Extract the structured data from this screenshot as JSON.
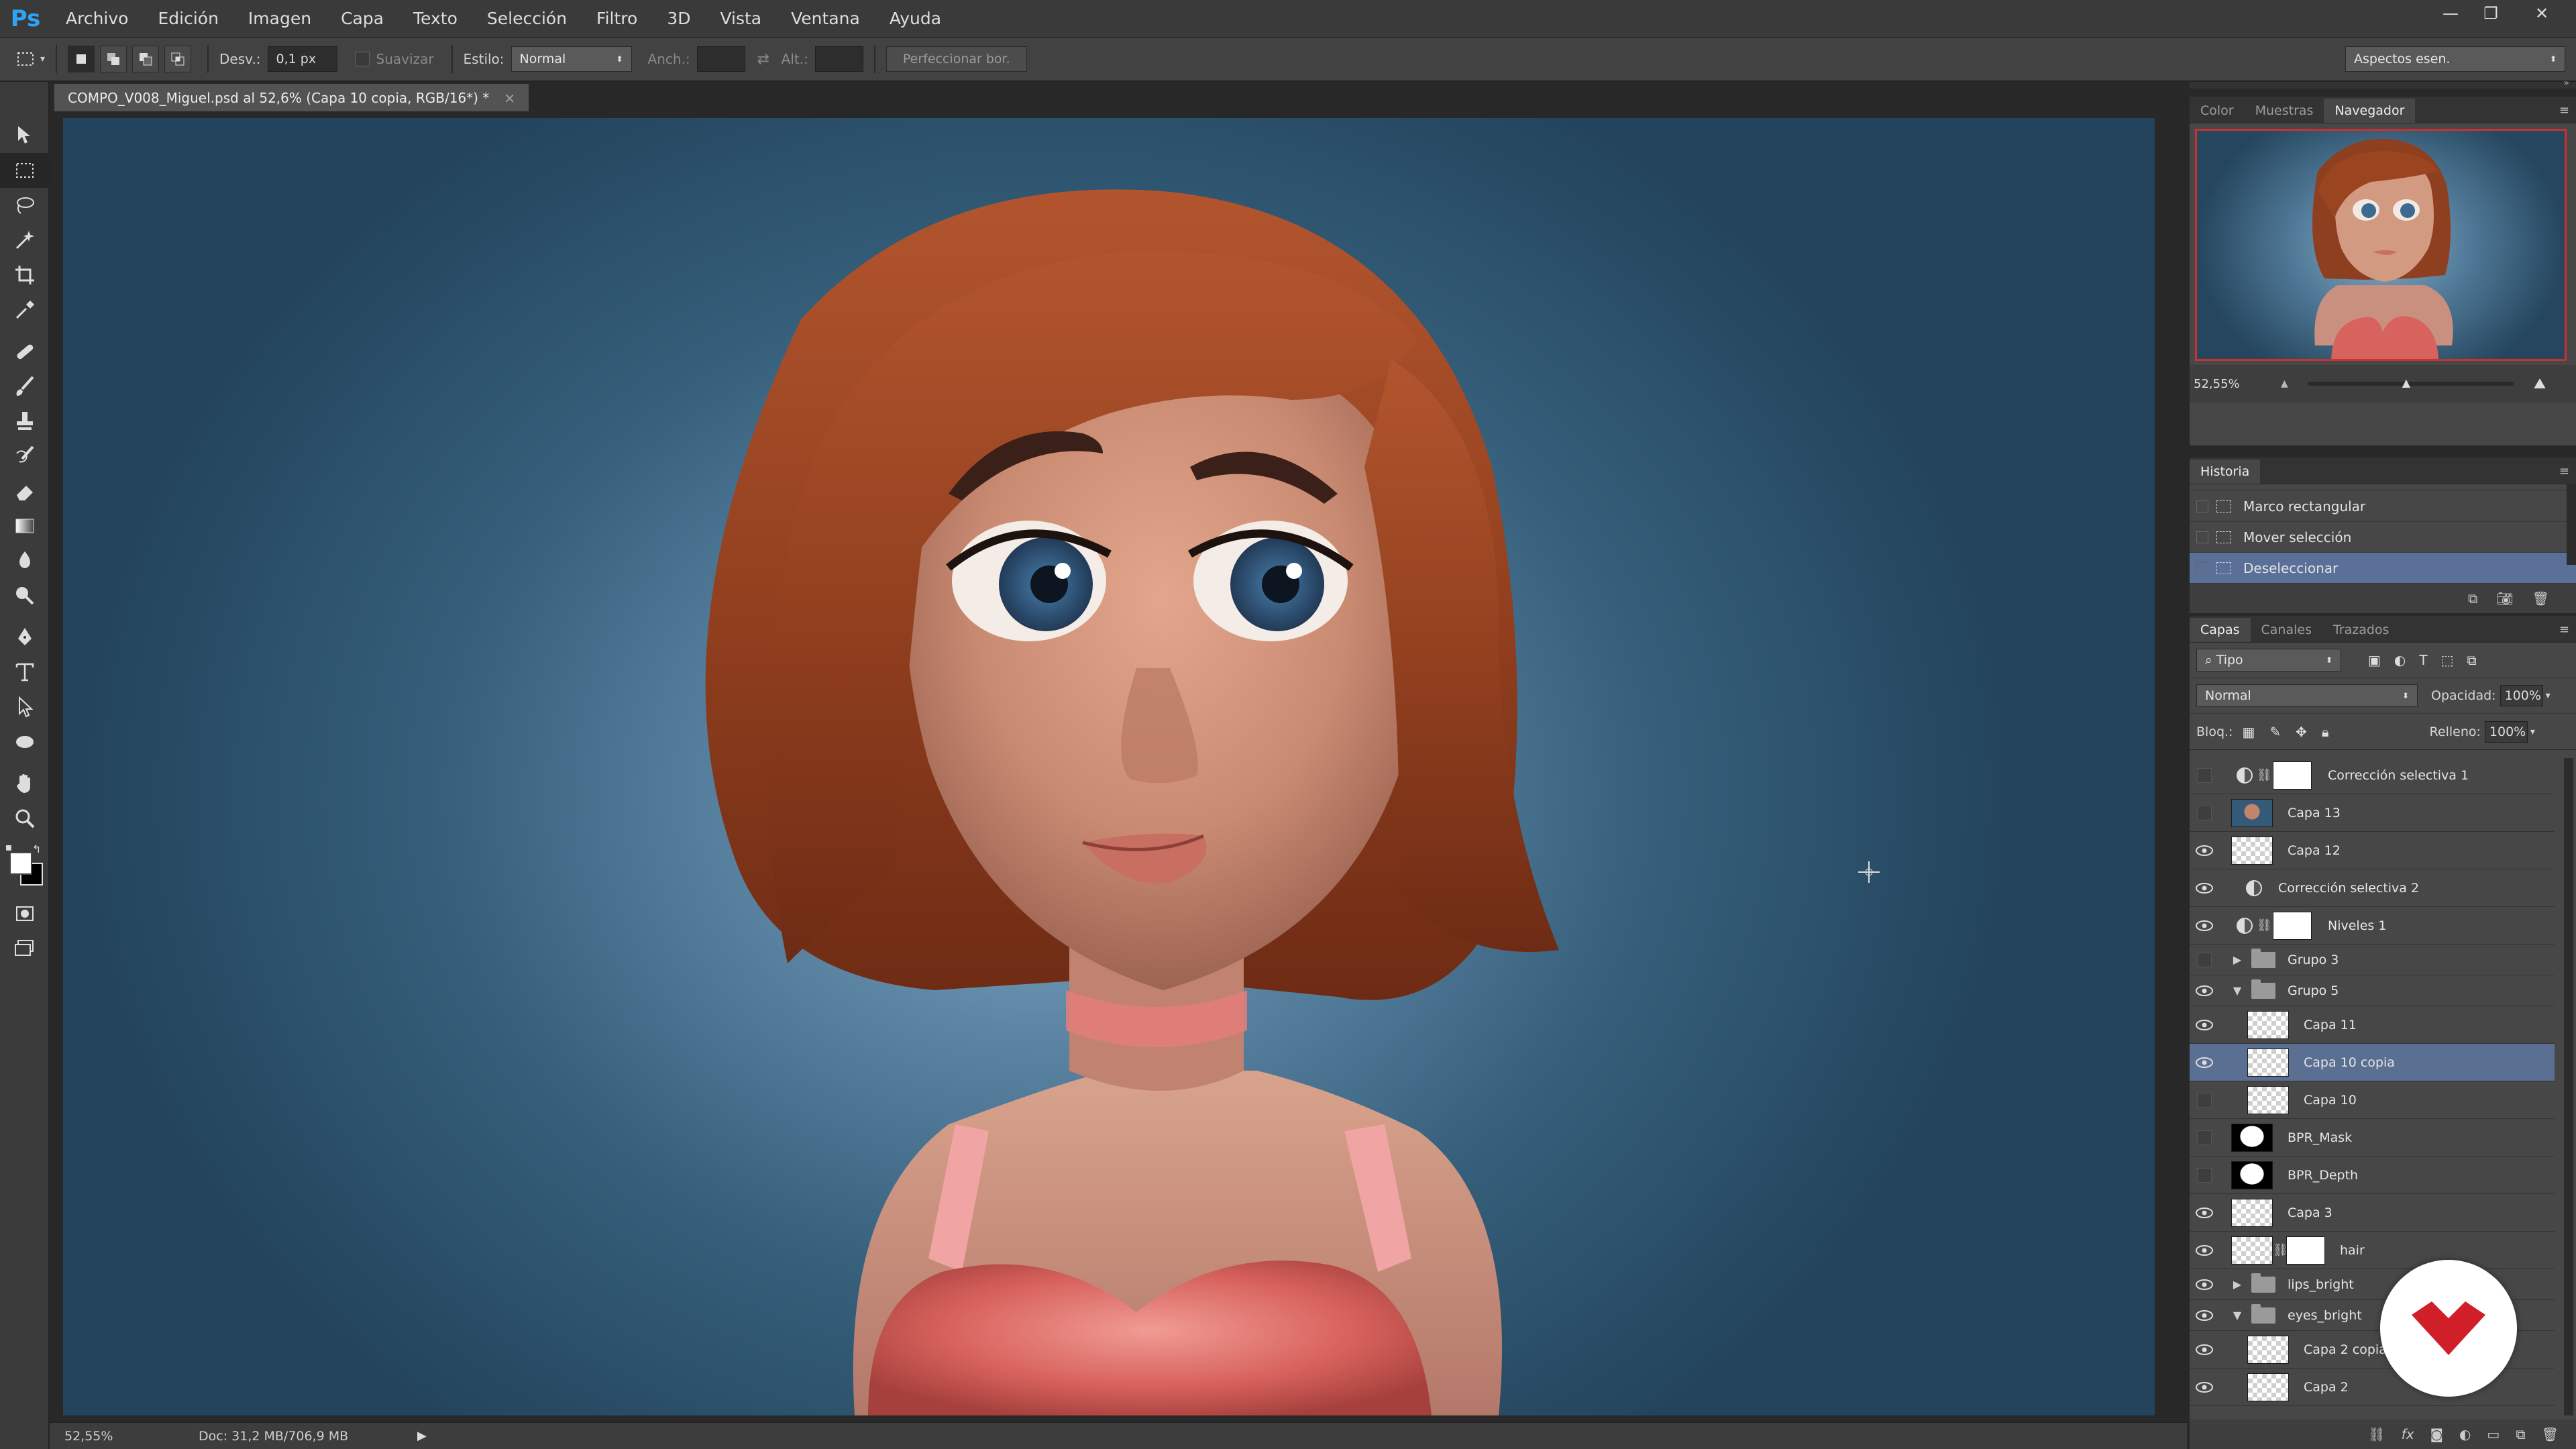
{
  "app": {
    "logo": "Ps"
  },
  "menu": [
    "Archivo",
    "Edición",
    "Imagen",
    "Capa",
    "Texto",
    "Selección",
    "Filtro",
    "3D",
    "Vista",
    "Ventana",
    "Ayuda"
  ],
  "options": {
    "desv_label": "Desv.:",
    "desv_value": "0,1 px",
    "suavizar_label": "Suavizar",
    "estilo_label": "Estilo:",
    "estilo_value": "Normal",
    "anch_label": "Anch.:",
    "alt_label": "Alt.:",
    "refine_button": "Perfeccionar bor.",
    "workspace": "Aspectos esen."
  },
  "document": {
    "tab_title": "COMPO_V008_Miguel.psd al 52,6% (Capa 10 copia, RGB/16*) *",
    "zoom": "52,55%",
    "doc_info": "Doc: 31,2 MB/706,9 MB"
  },
  "navigator": {
    "tabs": [
      "Color",
      "Muestras",
      "Navegador"
    ],
    "active_tab": "Navegador",
    "zoom": "52,55%"
  },
  "history": {
    "title": "Historia",
    "items": [
      "Marco rectangular",
      "Mover selección",
      "Deseleccionar"
    ],
    "selected": "Deseleccionar"
  },
  "layers": {
    "tabs": [
      "Capas",
      "Canales",
      "Trazados"
    ],
    "filter": "Tipo",
    "blend_mode": "Normal",
    "opacity_label": "Opacidad:",
    "opacity": "100%",
    "lock_label": "Bloq.:",
    "fill_label": "Relleno:",
    "fill": "100%",
    "items": [
      {
        "name": "Corrección selectiva 1",
        "visible": false,
        "type": "adjust-mask"
      },
      {
        "name": "Capa 13",
        "visible": false,
        "type": "image"
      },
      {
        "name": "Capa 12",
        "visible": true,
        "type": "pixel"
      },
      {
        "name": "Corrección selectiva 2",
        "visible": true,
        "type": "adjust"
      },
      {
        "name": "Niveles 1",
        "visible": true,
        "type": "adjust-mask"
      },
      {
        "name": "Grupo 3",
        "visible": false,
        "type": "group-closed"
      },
      {
        "name": "Grupo 5",
        "visible": true,
        "type": "group-open"
      },
      {
        "name": "Capa 11",
        "visible": true,
        "type": "pixel-indent"
      },
      {
        "name": "Capa 10 copia",
        "visible": true,
        "type": "pixel-indent",
        "selected": true
      },
      {
        "name": "Capa 10",
        "visible": false,
        "type": "pixel-indent"
      },
      {
        "name": "BPR_Mask",
        "visible": false,
        "type": "black"
      },
      {
        "name": "BPR_Depth",
        "visible": false,
        "type": "black"
      },
      {
        "name": "Capa 3",
        "visible": true,
        "type": "pixel"
      },
      {
        "name": "hair",
        "visible": true,
        "type": "pixel-mask"
      },
      {
        "name": "lips_bright",
        "visible": true,
        "type": "group-closed"
      },
      {
        "name": "eyes_bright",
        "visible": true,
        "type": "group-open"
      },
      {
        "name": "Capa 2 copia",
        "visible": true,
        "type": "pixel-indent"
      },
      {
        "name": "Capa 2",
        "visible": true,
        "type": "pixel-indent"
      }
    ]
  }
}
